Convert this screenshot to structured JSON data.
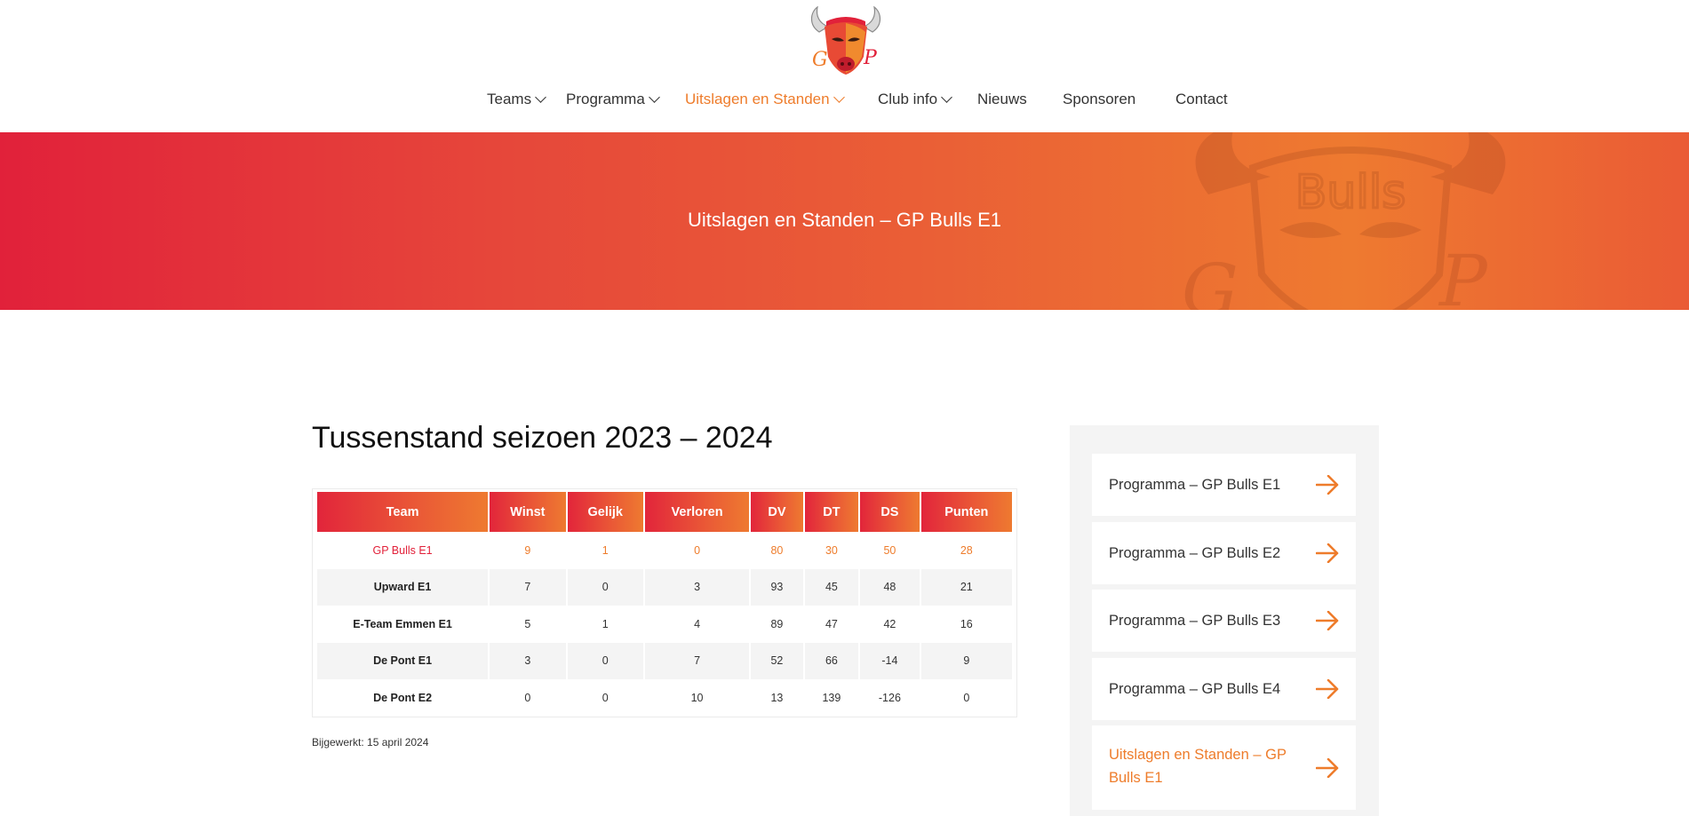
{
  "header": {
    "logo": {
      "name": "gp-bulls-logo",
      "letters": "GP"
    },
    "nav": [
      {
        "label": "Teams",
        "has_dropdown": true,
        "active": false
      },
      {
        "label": "Programma",
        "has_dropdown": true,
        "active": false
      },
      {
        "label": "Uitslagen en Standen",
        "has_dropdown": true,
        "active": true
      },
      {
        "label": "Club info",
        "has_dropdown": true,
        "active": false
      },
      {
        "label": "Nieuws",
        "has_dropdown": false,
        "active": false
      },
      {
        "label": "Sponsoren",
        "has_dropdown": false,
        "active": false
      },
      {
        "label": "Contact",
        "has_dropdown": false,
        "active": false
      }
    ]
  },
  "hero": {
    "title": "Uitslagen en Standen – GP Bulls E1",
    "watermark_text": "Bulls"
  },
  "main": {
    "title": "Tussenstand seizoen 2023 – 2024",
    "table": {
      "columns": [
        "Team",
        "Winst",
        "Gelijk",
        "Verloren",
        "DV",
        "DT",
        "DS",
        "Punten"
      ],
      "rows": [
        [
          "GP Bulls E1",
          "9",
          "1",
          "0",
          "80",
          "30",
          "50",
          "28"
        ],
        [
          "Upward E1",
          "7",
          "0",
          "3",
          "93",
          "45",
          "48",
          "21"
        ],
        [
          "E-Team Emmen E1",
          "5",
          "1",
          "4",
          "89",
          "47",
          "42",
          "16"
        ],
        [
          "De Pont E1",
          "3",
          "0",
          "7",
          "52",
          "66",
          "-14",
          "9"
        ],
        [
          "De Pont E2",
          "0",
          "0",
          "10",
          "13",
          "139",
          "-126",
          "0"
        ]
      ]
    },
    "updated": "Bijgewerkt: 15 april 2024"
  },
  "sidebar": {
    "items": [
      {
        "label": "Programma – GP Bulls E1",
        "active": false
      },
      {
        "label": "Programma – GP Bulls E2",
        "active": false
      },
      {
        "label": "Programma – GP Bulls E3",
        "active": false
      },
      {
        "label": "Programma – GP Bulls E4",
        "active": false
      },
      {
        "label": "Uitslagen en Standen – GP Bulls E1",
        "active": true
      }
    ]
  },
  "colors": {
    "accent": "#ee7c2b",
    "brand_red": "#e1213a",
    "hero_orange": "#ee7a30"
  }
}
